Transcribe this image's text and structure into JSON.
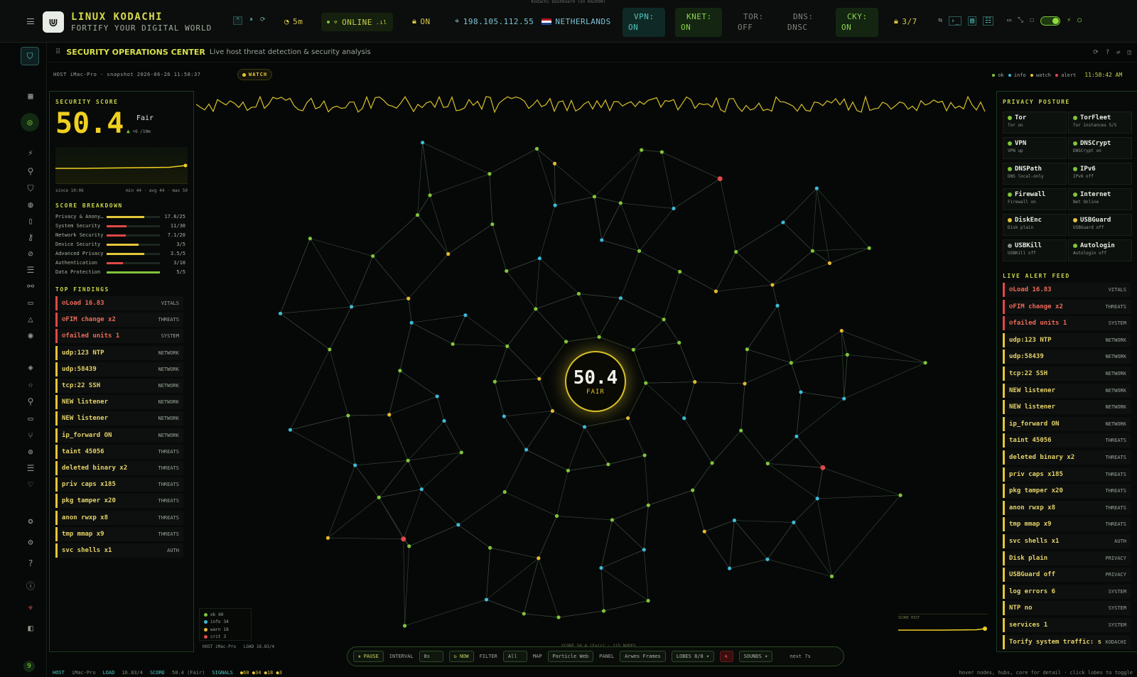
{
  "window_title": "Kodachi Dashboard (on KA2000)",
  "brand": {
    "name": "LINUX KODACHI",
    "tagline": "FORTIFY YOUR DIGITAL WORLD"
  },
  "topbar": {
    "timer": "5m",
    "online": "ONLINE",
    "lock": "ON",
    "ip": "198.105.112.55",
    "country": "NETHERLANDS",
    "vpn": [
      "VPN:",
      "ON"
    ],
    "knet": [
      "KNET:",
      "ON"
    ],
    "tor": [
      "TOR:",
      "OFF"
    ],
    "dns": [
      "DNS:",
      "DNSC"
    ],
    "cky": [
      "CKY:",
      "ON"
    ],
    "count": "3/7"
  },
  "header": {
    "title": "SECURITY OPERATIONS CENTER",
    "subtitle": "Live host threat detection & security analysis"
  },
  "snapshot": {
    "host_line": "HOST iMac-Pro · snapshot 2026-06-26 11:58:37",
    "badge": "WATCH",
    "legend": [
      "ok",
      "info",
      "watch",
      "alert"
    ],
    "clock": "11:58:42 AM"
  },
  "score_panel": {
    "title": "SECURITY SCORE",
    "score": "50.4",
    "grade": "Fair",
    "delta": "+6 /10m",
    "since": "since 10:06",
    "stats": "min 44 · avg 44 · max 50",
    "breakdown_title": "SCORE BREAKDOWN",
    "breakdown": [
      {
        "label": "Privacy & Anony…",
        "value": "17.8/25",
        "pct": 0.71,
        "color": "#e5c63a"
      },
      {
        "label": "System Security",
        "value": "11/30",
        "pct": 0.37,
        "color": "#e04848"
      },
      {
        "label": "Network Security",
        "value": "7.1/20",
        "pct": 0.36,
        "color": "#e04848"
      },
      {
        "label": "Device Security",
        "value": "3/5",
        "pct": 0.6,
        "color": "#e5c63a"
      },
      {
        "label": "Advanced Privacy",
        "value": "3.5/5",
        "pct": 0.7,
        "color": "#e5c63a"
      },
      {
        "label": "Authentication",
        "value": "3/10",
        "pct": 0.3,
        "color": "#e04848"
      },
      {
        "label": "Data Protection",
        "value": "5/5",
        "pct": 1.0,
        "color": "#7fc53a"
      }
    ],
    "findings_title": "TOP FINDINGS",
    "findings": [
      {
        "text": "⊘Load 16.83",
        "cat": "VITALS",
        "level": "alert"
      },
      {
        "text": "⊘FIM change x2",
        "cat": "THREATS",
        "level": "alert"
      },
      {
        "text": "⊘failed units 1",
        "cat": "SYSTEM",
        "level": "alert"
      },
      {
        "text": "udp:123 NTP",
        "cat": "NETWORK",
        "level": "watch"
      },
      {
        "text": "udp:58439",
        "cat": "NETWORK",
        "level": "watch"
      },
      {
        "text": "tcp:22 SSH",
        "cat": "NETWORK",
        "level": "watch"
      },
      {
        "text": "NEW listener",
        "cat": "NETWORK",
        "level": "watch"
      },
      {
        "text": "NEW listener",
        "cat": "NETWORK",
        "level": "watch"
      },
      {
        "text": "ip_forward ON",
        "cat": "NETWORK",
        "level": "watch"
      },
      {
        "text": "taint 45056",
        "cat": "THREATS",
        "level": "watch"
      },
      {
        "text": "deleted binary x2",
        "cat": "THREATS",
        "level": "watch"
      },
      {
        "text": "priv caps x185",
        "cat": "THREATS",
        "level": "watch"
      },
      {
        "text": "pkg tamper x20",
        "cat": "THREATS",
        "level": "watch"
      },
      {
        "text": "anon rwxp x8",
        "cat": "THREATS",
        "level": "watch"
      },
      {
        "text": "tmp mmap x9",
        "cat": "THREATS",
        "level": "watch"
      },
      {
        "text": "svc shells x1",
        "cat": "AUTH",
        "level": "watch"
      }
    ]
  },
  "center": {
    "score": "50.4",
    "grade": "FAIR",
    "legend": [
      {
        "label": "ok",
        "count": "60",
        "color": "#7fc53a"
      },
      {
        "label": "info",
        "count": "34",
        "color": "#3fb8d8"
      },
      {
        "label": "warn",
        "count": "18",
        "color": "#e5b830"
      },
      {
        "label": "crit",
        "count": "3",
        "color": "#e04848"
      }
    ],
    "host_load": "HOST iMac-Pro   LOAD 16.83/4",
    "score_caption": "SCORE 50.4 (Fair) · 115 NODES",
    "score_hist_label": "SCORE HIST"
  },
  "privacy_panel": {
    "title": "PRIVACY POSTURE",
    "cards": [
      {
        "name": "Tor",
        "sub": "Tor on",
        "color": "#7fc53a"
      },
      {
        "name": "TorFleet",
        "sub": "Tor instances 5/5",
        "color": "#7fc53a"
      },
      {
        "name": "VPN",
        "sub": "VPN up",
        "color": "#7fc53a"
      },
      {
        "name": "DNSCrypt",
        "sub": "DNSCrypt on",
        "color": "#7fc53a"
      },
      {
        "name": "DNSPath",
        "sub": "DNS local-only",
        "color": "#7fc53a"
      },
      {
        "name": "IPv6",
        "sub": "IPv6 off",
        "color": "#7fc53a"
      },
      {
        "name": "Firewall",
        "sub": "Firewall on",
        "color": "#7fc53a"
      },
      {
        "name": "Internet",
        "sub": "Net Online",
        "color": "#7fc53a"
      },
      {
        "name": "DiskEnc",
        "sub": "Disk plain",
        "color": "#e5c63a"
      },
      {
        "name": "USBGuard",
        "sub": "USBGuard off",
        "color": "#e5c63a"
      },
      {
        "name": "USBKill",
        "sub": "USBKill off",
        "color": "#8a8f88"
      },
      {
        "name": "Autologin",
        "sub": "Autologin off",
        "color": "#7fc53a"
      }
    ],
    "feed_title": "LIVE ALERT FEED",
    "feed": [
      {
        "text": "⊘Load 16.83",
        "cat": "VITALS",
        "level": "alert"
      },
      {
        "text": "⊘FIM change x2",
        "cat": "THREATS",
        "level": "alert"
      },
      {
        "text": "⊘failed units 1",
        "cat": "SYSTEM",
        "level": "alert"
      },
      {
        "text": "udp:123 NTP",
        "cat": "NETWORK",
        "level": "watch"
      },
      {
        "text": "udp:58439",
        "cat": "NETWORK",
        "level": "watch"
      },
      {
        "text": "tcp:22 SSH",
        "cat": "NETWORK",
        "level": "watch"
      },
      {
        "text": "NEW listener",
        "cat": "NETWORK",
        "level": "watch"
      },
      {
        "text": "NEW listener",
        "cat": "NETWORK",
        "level": "watch"
      },
      {
        "text": "ip_forward ON",
        "cat": "NETWORK",
        "level": "watch"
      },
      {
        "text": "taint 45056",
        "cat": "THREATS",
        "level": "watch"
      },
      {
        "text": "deleted binary x2",
        "cat": "THREATS",
        "level": "watch"
      },
      {
        "text": "priv caps x185",
        "cat": "THREATS",
        "level": "watch"
      },
      {
        "text": "pkg tamper x20",
        "cat": "THREATS",
        "level": "watch"
      },
      {
        "text": "anon rwxp x8",
        "cat": "THREATS",
        "level": "watch"
      },
      {
        "text": "tmp mmap x9",
        "cat": "THREATS",
        "level": "watch"
      },
      {
        "text": "svc shells x1",
        "cat": "AUTH",
        "level": "watch"
      },
      {
        "text": "Disk plain",
        "cat": "PRIVACY",
        "level": "watch"
      },
      {
        "text": "USBGuard off",
        "cat": "PRIVACY",
        "level": "watch"
      },
      {
        "text": "log errors 6",
        "cat": "SYSTEM",
        "level": "watch"
      },
      {
        "text": "NTP no",
        "cat": "SYSTEM",
        "level": "watch"
      },
      {
        "text": "services 1",
        "cat": "SYSTEM",
        "level": "watch"
      },
      {
        "text": "Torify system traffic: sudo routing-switch tor",
        "cat": "KODACHI",
        "level": "watch"
      }
    ]
  },
  "controls": {
    "pause": "⏸ PAUSE",
    "interval_label": "INTERVAL",
    "interval": "8s",
    "now": "↻ NOW",
    "filter_label": "FILTER",
    "filter": "All",
    "map_label": "MAP",
    "map": "Particle Web",
    "panel_label": "PANEL",
    "panel": "Arwes Frames",
    "lobes": "LOBES 8/8 ▾",
    "sounds": "SOUNDS ▾",
    "next": "next 7s"
  },
  "statusbar": {
    "host_label": "HOST",
    "host": "iMac-Pro",
    "load_label": "LOAD",
    "load": "16.83/4",
    "score_label": "SCORE",
    "score": "50.4 (Fair)",
    "signals_label": "SIGNALS",
    "signals": "●60 ●34 ●18 ●3",
    "hint": "hover nodes, hubs, core for detail · click lobes to toggle"
  },
  "rail_badge": "9",
  "colors": {
    "ok": "#7fc53a",
    "info": "#3fb8d8",
    "watch": "#e5c63a",
    "alert": "#e04848",
    "accent": "#e8d640"
  }
}
